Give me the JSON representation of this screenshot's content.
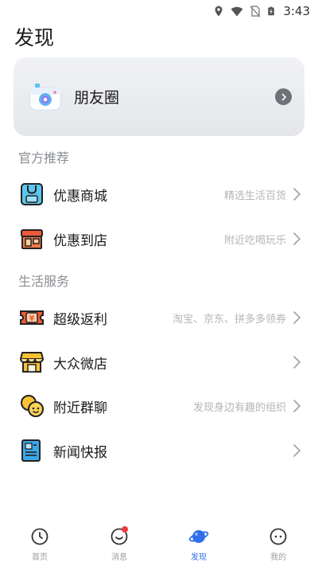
{
  "status_bar": {
    "time": "3:43",
    "icons": [
      "location-icon",
      "wifi-icon",
      "no-sim-icon",
      "battery-charging-icon"
    ]
  },
  "page": {
    "title": "发现"
  },
  "moments": {
    "label": "朋友圈",
    "icon": "camera-icon"
  },
  "sections": [
    {
      "title": "官方推荐",
      "items": [
        {
          "label": "优惠商城",
          "hint": "精选生活百货",
          "icon": "shopping-bag-icon"
        },
        {
          "label": "优惠到店",
          "hint": "附近吃喝玩乐",
          "icon": "storefront-icon"
        }
      ]
    },
    {
      "title": "生活服务",
      "items": [
        {
          "label": "超级返利",
          "hint": "淘宝、京东、拼多多领券",
          "icon": "coupon-icon"
        },
        {
          "label": "大众微店",
          "hint": "",
          "icon": "shop-icon"
        },
        {
          "label": "附近群聊",
          "hint": "发现身边有趣的组织",
          "icon": "group-chat-icon"
        },
        {
          "label": "新闻快报",
          "hint": "",
          "icon": "newspaper-icon"
        }
      ]
    }
  ],
  "nav": {
    "items": [
      {
        "label": "首页",
        "icon": "home-icon"
      },
      {
        "label": "消息",
        "icon": "message-icon"
      },
      {
        "label": "发现",
        "icon": "planet-icon",
        "active": true
      },
      {
        "label": "我的",
        "icon": "profile-icon"
      }
    ]
  },
  "colors": {
    "accent": "#2f6fea",
    "badge": "#f23a3a",
    "hint_text": "#b3b5b9",
    "section_title": "#8a8d92"
  }
}
